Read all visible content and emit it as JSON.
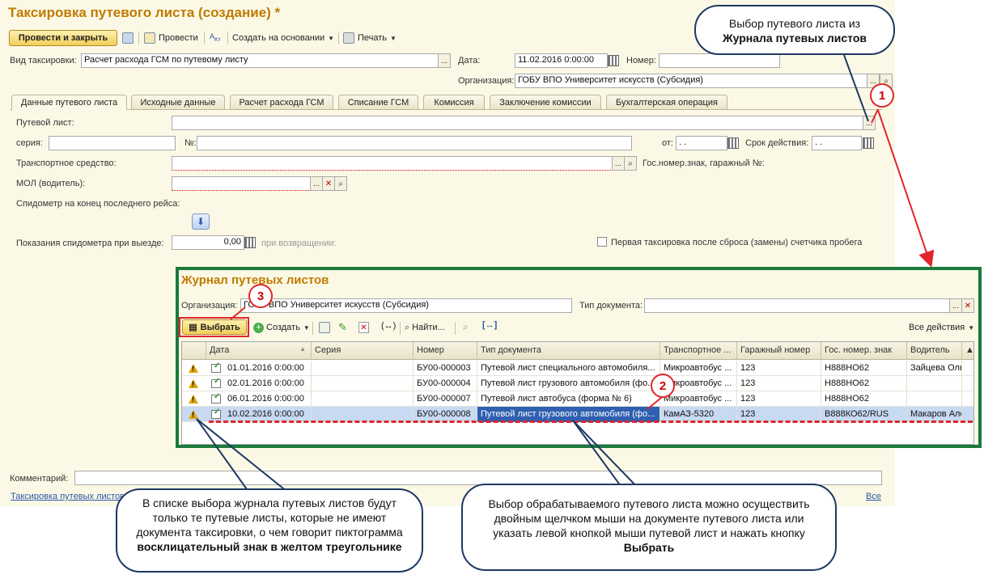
{
  "form": {
    "title": "Таксировка путевого листа (создание) *",
    "toolbar": {
      "post_close": "Провести и закрыть",
      "post": "Провести",
      "create_based_on": "Создать на основании",
      "print": "Печать"
    },
    "header": {
      "type_label": "Вид таксировки:",
      "type_value": "Расчет расхода ГСМ по путевому листу",
      "date_label": "Дата:",
      "date_value": "11.02.2016  0:00:00",
      "number_label": "Номер:",
      "number_value": "",
      "org_label": "Организация:",
      "org_value": "ГОБУ ВПО Университет искусств (Субсидия)"
    },
    "tabs": [
      "Данные путевого листа",
      "Исходные данные",
      "Расчет расхода ГСМ",
      "Списание ГСМ",
      "Комиссия",
      "Заключение комиссии",
      "Бухгалтерская операция"
    ],
    "fields": {
      "waybill_label": "Путевой лист:",
      "series_label": "серия:",
      "no_label": "№:",
      "from_label": "от:",
      "from_value": ". .",
      "validity_label": "Срок действия:",
      "validity_value": ". .",
      "vehicle_label": "Транспортное средство:",
      "plate_label": "Гос.номер.знак, гаражный №:",
      "mol_label": "МОЛ (водитель):",
      "speedometer_label": "Спидометр на конец последнего рейса:",
      "reading_out_label": "Показания спидометра при выезде:",
      "reading_out_value": "0,00",
      "reading_in_label": "при возвращении:",
      "first_tax_label": "Первая таксировка после сброса (замены) счетчика пробега"
    },
    "comment_label": "Комментарий:",
    "footer_link": "Таксировка путевых листов",
    "footer_all": "Все"
  },
  "journal": {
    "title": "Журнал путевых листов",
    "org_label": "Организация:",
    "org_value": "ГОБУ ВПО Университет искусств (Субсидия)",
    "doctype_label": "Тип документа:",
    "toolbar": {
      "select": "Выбрать",
      "create": "Создать",
      "find": "Найти...",
      "all_actions": "Все действия"
    },
    "columns": [
      "Дата",
      "Серия",
      "Номер",
      "Тип документа",
      "Транспортное ...",
      "Гаражный номер",
      "Гос. номер. знак",
      "Водитель"
    ],
    "rows": [
      {
        "date": "01.01.2016 0:00:00",
        "series": "",
        "number": "БУ00-000003",
        "doctype": "Путевой лист специального автомобиля...",
        "vehicle": "Микроавтобус ...",
        "garage": "123",
        "plate": "Н888НО62",
        "driver": "Зайцева Оль"
      },
      {
        "date": "02.01.2016 0:00:00",
        "series": "",
        "number": "БУ00-000004",
        "doctype": "Путевой лист грузового автомобиля (фо...",
        "vehicle": "Микроавтобус ...",
        "garage": "123",
        "plate": "Н888НО62",
        "driver": ""
      },
      {
        "date": "06.01.2016 0:00:00",
        "series": "",
        "number": "БУ00-000007",
        "doctype": "Путевой лист автобуса (форма № 6)",
        "vehicle": "Микроавтобус ...",
        "garage": "123",
        "plate": "Н888НО62",
        "driver": ""
      },
      {
        "date": "10.02.2016 0:00:00",
        "series": "",
        "number": "БУ00-000008",
        "doctype": "Путевой лист грузового автомобиля (фо...",
        "vehicle": "КамАЗ-5320",
        "garage": "123",
        "plate": "В888КО62/RUS",
        "driver": "Макаров Але"
      }
    ]
  },
  "callouts": {
    "top_line1": "Выбор путевого листа из",
    "top_line2": "Журнала путевых листов",
    "left_text": "В списке выбора журнала путевых листов будут только те путевые листы, которые не имеют документа таксировки, о чем говорит пиктограмма",
    "left_bold": "восклицательный знак в желтом треугольнике",
    "right_text": "Выбор обрабатываемого путевого листа можно осуществить двойным щелчком мыши на документе путевого листа или указать левой кнопкой мыши путевой лист и нажать кнопку",
    "right_bold": "Выбрать",
    "num1": "1",
    "num2": "2",
    "num3": "3"
  },
  "colors": {
    "accent": "#c07a00",
    "journal_border": "#1a7a3c",
    "callout_border": "#1f3864",
    "marker": "#e0262a"
  }
}
